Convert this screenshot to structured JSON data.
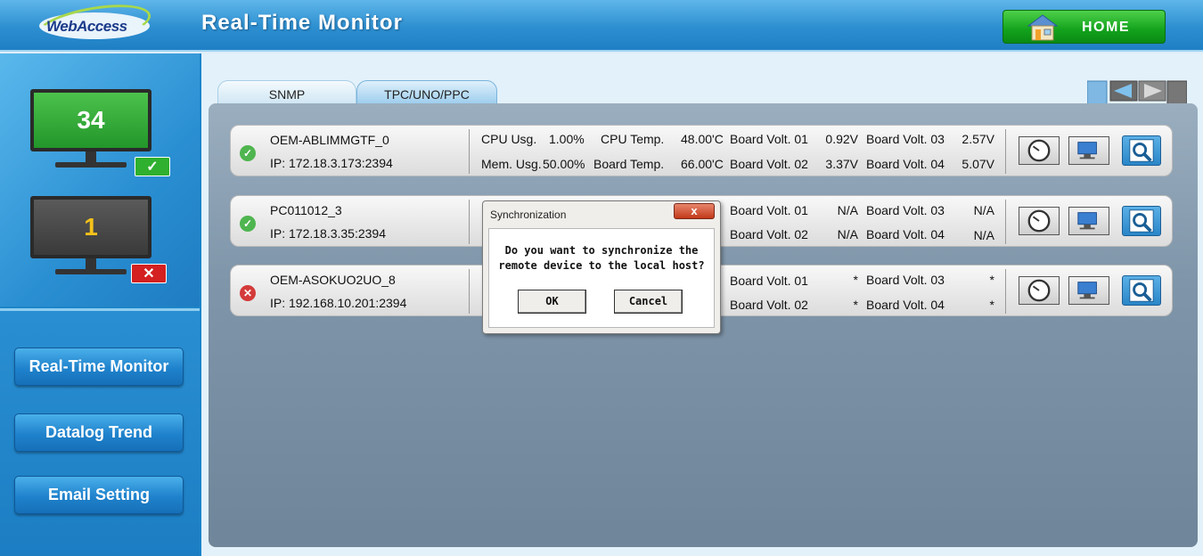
{
  "header": {
    "logo_text": "WebAccess",
    "title": "Real-Time Monitor",
    "home_label": "HOME"
  },
  "summary": {
    "online_count": "34",
    "offline_count": "1"
  },
  "sidebar": {
    "items": [
      {
        "label": "Real-Time Monitor"
      },
      {
        "label": "Datalog Trend"
      },
      {
        "label": "Email Setting"
      }
    ]
  },
  "tabs": [
    {
      "label": "SNMP"
    },
    {
      "label": "TPC/UNO/PPC"
    }
  ],
  "labels": {
    "cpu_usg": "CPU Usg.",
    "cpu_temp": "CPU Temp.",
    "mem_usg": "Mem. Usg.",
    "board_temp": "Board Temp.",
    "bv01": "Board Volt. 01",
    "bv02": "Board Volt. 02",
    "bv03": "Board Volt. 03",
    "bv04": "Board Volt. 04"
  },
  "devices": [
    {
      "status": "ok",
      "name": "OEM-ABLIMMGTF_0",
      "ip": "IP: 172.18.3.173:2394",
      "cpu_usg": "1.00%",
      "cpu_temp": "48.00'C",
      "mem_usg": "50.00%",
      "board_temp": "66.00'C",
      "bv01": "0.92V",
      "bv02": "3.37V",
      "bv03": "2.57V",
      "bv04": "5.07V"
    },
    {
      "status": "ok",
      "name": "PC011012_3",
      "ip": "IP: 172.18.3.35:2394",
      "bv01": "N/A",
      "bv02": "N/A",
      "bv03": "N/A",
      "bv04": "N/A"
    },
    {
      "status": "error",
      "name": "OEM-ASOKUO2UO_8",
      "ip": "IP: 192.168.10.201:2394",
      "bv01": "*",
      "bv02": "*",
      "bv03": "*",
      "bv04": "*"
    }
  ],
  "dialog": {
    "title": "Synchronization",
    "close_glyph": "x",
    "message_line1": "Do you want to synchronize the",
    "message_line2": "remote device to the local host?",
    "ok_label": "OK",
    "cancel_label": "Cancel"
  },
  "icons": {
    "check": "✓",
    "cross": "✕",
    "row_ok": "✓",
    "row_error": "✕"
  }
}
